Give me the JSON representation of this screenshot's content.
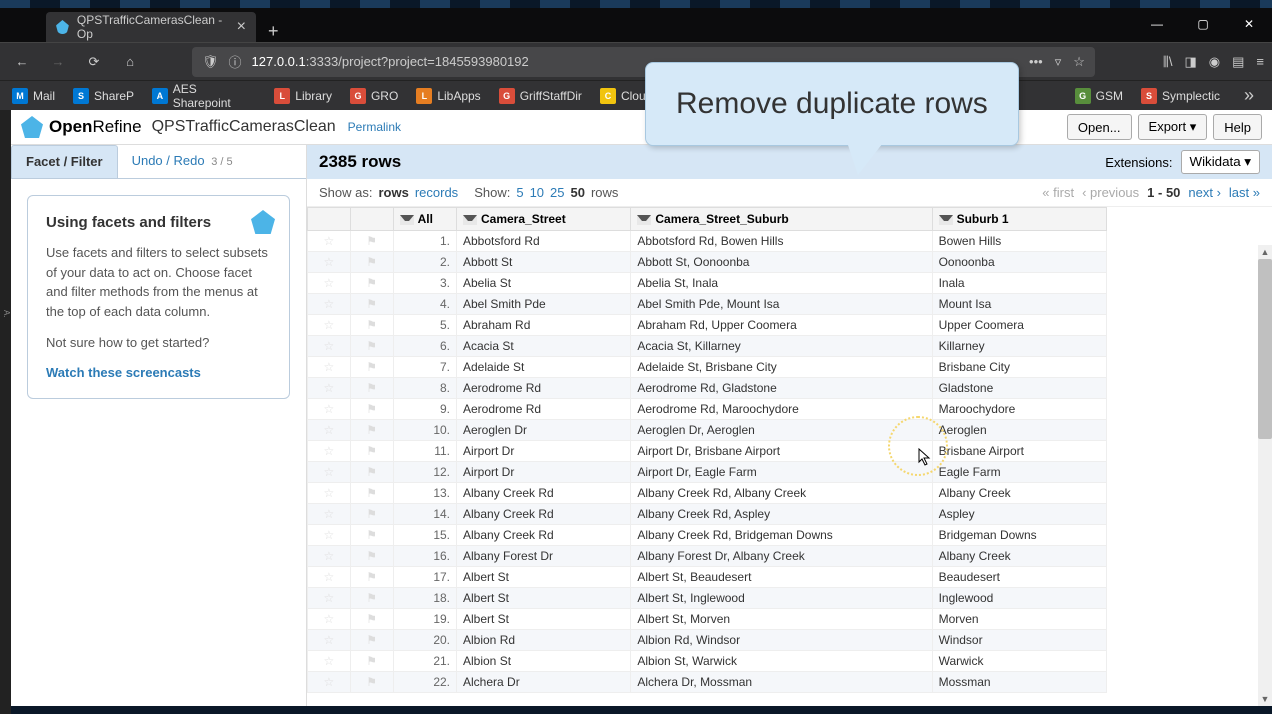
{
  "browser": {
    "tab_title": "QPSTrafficCamerasClean - Op",
    "url_display": "127.0.0.1:3333/project?project=1845593980192",
    "url_host": "127.0.0.1",
    "bookmarks": [
      {
        "label": "Mail",
        "color": "bm-blue"
      },
      {
        "label": "ShareP",
        "color": "bm-blue"
      },
      {
        "label": "AES Sharepoint",
        "color": "bm-blue"
      },
      {
        "label": "Library",
        "color": "bm-red"
      },
      {
        "label": "GRO",
        "color": "bm-red"
      },
      {
        "label": "LibApps",
        "color": "bm-orange"
      },
      {
        "label": "GriffStaffDir",
        "color": "bm-red"
      },
      {
        "label": "CloudStor",
        "color": "bm-yellow"
      },
      {
        "label": "GSM",
        "color": "bm-green"
      },
      {
        "label": "Symplectic",
        "color": "bm-red"
      }
    ]
  },
  "openrefine": {
    "brand1": "Open",
    "brand2": "Refine",
    "project": "QPSTrafficCamerasClean",
    "permalink": "Permalink",
    "open": "Open...",
    "export": "Export ▾",
    "help": "Help",
    "facet_tab": "Facet / Filter",
    "undo_tab": "Undo / Redo",
    "undo_counts": "3 / 5",
    "facet_title": "Using facets and filters",
    "facet_text": "Use facets and filters to select subsets of your data to act on. Choose facet and filter methods from the menus at the top of each data column.",
    "facet_q": "Not sure how to get started?",
    "facet_link": "Watch these screencasts",
    "rows_count": "2385 rows",
    "extensions": "Extensions:",
    "wikidata": "Wikidata ▾",
    "show_as": "Show as:",
    "rows_opt": "rows",
    "records_opt": "records",
    "show": "Show:",
    "sizes": [
      "5",
      "10",
      "25",
      "50"
    ],
    "rows_suffix": "rows",
    "pager_first": "« first",
    "pager_prev": "‹ previous",
    "pager_range": "1 - 50",
    "pager_next": "next ›",
    "pager_last": "last »",
    "col_all": "All",
    "col1": "Camera_Street",
    "col2": "Camera_Street_Suburb",
    "col3": "Suburb 1"
  },
  "callout": "Remove duplicate rows",
  "rows": [
    {
      "n": "1.",
      "a": "Abbotsford Rd",
      "b": "Abbotsford Rd, Bowen Hills",
      "c": "Bowen Hills"
    },
    {
      "n": "2.",
      "a": "Abbott St",
      "b": "Abbott St, Oonoonba",
      "c": "Oonoonba"
    },
    {
      "n": "3.",
      "a": "Abelia St",
      "b": "Abelia St, Inala",
      "c": "Inala"
    },
    {
      "n": "4.",
      "a": "Abel Smith Pde",
      "b": "Abel Smith Pde, Mount Isa",
      "c": "Mount Isa"
    },
    {
      "n": "5.",
      "a": "Abraham Rd",
      "b": "Abraham Rd, Upper Coomera",
      "c": "Upper Coomera"
    },
    {
      "n": "6.",
      "a": "Acacia St",
      "b": "Acacia St, Killarney",
      "c": "Killarney"
    },
    {
      "n": "7.",
      "a": "Adelaide St",
      "b": "Adelaide St, Brisbane City",
      "c": "Brisbane City"
    },
    {
      "n": "8.",
      "a": "Aerodrome Rd",
      "b": "Aerodrome Rd, Gladstone",
      "c": "Gladstone"
    },
    {
      "n": "9.",
      "a": "Aerodrome Rd",
      "b": "Aerodrome Rd, Maroochydore",
      "c": "Maroochydore"
    },
    {
      "n": "10.",
      "a": "Aeroglen Dr",
      "b": "Aeroglen Dr, Aeroglen",
      "c": "Aeroglen"
    },
    {
      "n": "11.",
      "a": "Airport Dr",
      "b": "Airport Dr, Brisbane Airport",
      "c": "Brisbane Airport"
    },
    {
      "n": "12.",
      "a": "Airport Dr",
      "b": "Airport Dr, Eagle Farm",
      "c": "Eagle Farm"
    },
    {
      "n": "13.",
      "a": "Albany Creek Rd",
      "b": "Albany Creek Rd, Albany Creek",
      "c": "Albany Creek"
    },
    {
      "n": "14.",
      "a": "Albany Creek Rd",
      "b": "Albany Creek Rd, Aspley",
      "c": "Aspley"
    },
    {
      "n": "15.",
      "a": "Albany Creek Rd",
      "b": "Albany Creek Rd, Bridgeman Downs",
      "c": "Bridgeman Downs"
    },
    {
      "n": "16.",
      "a": "Albany Forest Dr",
      "b": "Albany Forest Dr, Albany Creek",
      "c": "Albany Creek"
    },
    {
      "n": "17.",
      "a": "Albert St",
      "b": "Albert St, Beaudesert",
      "c": "Beaudesert"
    },
    {
      "n": "18.",
      "a": "Albert St",
      "b": "Albert St, Inglewood",
      "c": "Inglewood"
    },
    {
      "n": "19.",
      "a": "Albert St",
      "b": "Albert St, Morven",
      "c": "Morven"
    },
    {
      "n": "20.",
      "a": "Albion Rd",
      "b": "Albion Rd, Windsor",
      "c": "Windsor"
    },
    {
      "n": "21.",
      "a": "Albion St",
      "b": "Albion St, Warwick",
      "c": "Warwick"
    },
    {
      "n": "22.",
      "a": "Alchera Dr",
      "b": "Alchera Dr, Mossman",
      "c": "Mossman"
    }
  ]
}
